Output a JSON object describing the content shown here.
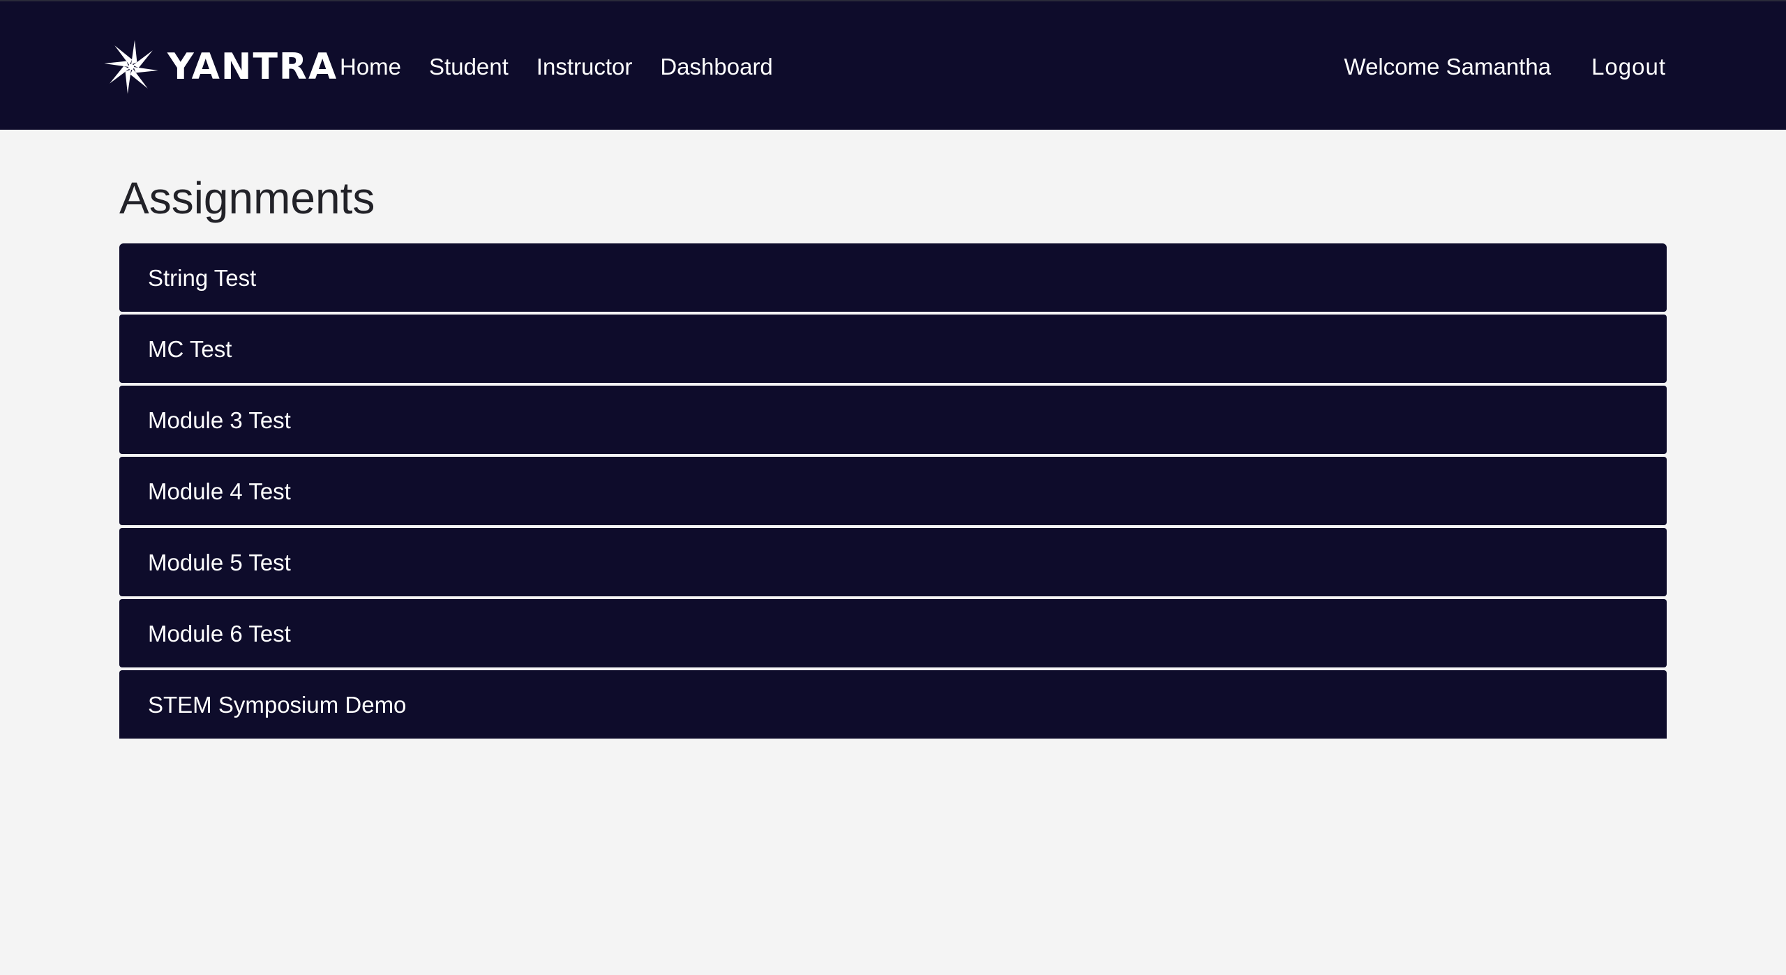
{
  "navbar": {
    "brand_name": "YANTRA",
    "links": [
      {
        "label": "Home"
      },
      {
        "label": "Student"
      },
      {
        "label": "Instructor"
      },
      {
        "label": "Dashboard"
      }
    ],
    "welcome_text": "Welcome Samantha",
    "logout_label": "Logout"
  },
  "main": {
    "title": "Assignments",
    "assignments": [
      {
        "label": "String Test"
      },
      {
        "label": "MC Test"
      },
      {
        "label": "Module 3 Test"
      },
      {
        "label": "Module 4 Test"
      },
      {
        "label": "Module 5 Test"
      },
      {
        "label": "Module 6 Test"
      },
      {
        "label": "STEM Symposium Demo"
      }
    ]
  },
  "colors": {
    "navbar_bg": "#0e0c2b",
    "page_bg": "#f4f4f4",
    "item_bg": "#0e0c2b",
    "text_light": "#ffffff",
    "title_text": "#222228"
  },
  "icons": {
    "brand": "pinwheel-star-logo-icon"
  }
}
